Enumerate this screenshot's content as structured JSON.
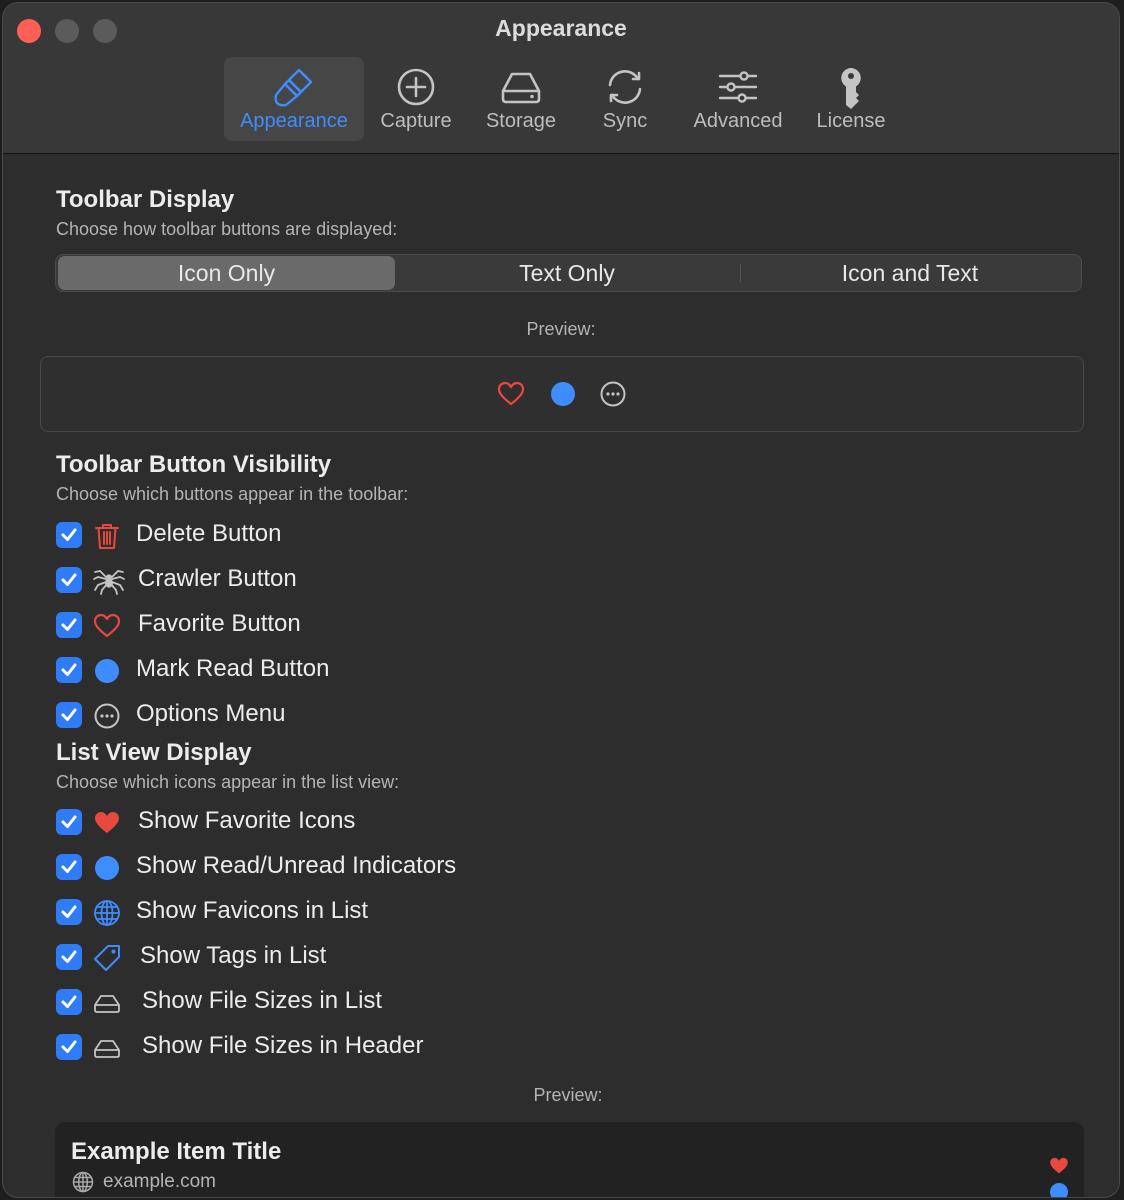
{
  "window": {
    "title": "Appearance"
  },
  "tabs": [
    {
      "label": "Appearance",
      "icon": "paintbrush-icon",
      "selected": true
    },
    {
      "label": "Capture",
      "icon": "plus-circle-icon",
      "selected": false
    },
    {
      "label": "Storage",
      "icon": "drive-icon",
      "selected": false
    },
    {
      "label": "Sync",
      "icon": "sync-arrows-icon",
      "selected": false
    },
    {
      "label": "Advanced",
      "icon": "sliders-icon",
      "selected": false
    },
    {
      "label": "License",
      "icon": "key-icon",
      "selected": false
    }
  ],
  "toolbar_display": {
    "title": "Toolbar Display",
    "subtitle": "Choose how toolbar buttons are displayed:",
    "options": [
      "Icon Only",
      "Text Only",
      "Icon and Text"
    ],
    "selected": "Icon Only",
    "preview_label": "Preview:"
  },
  "button_visibility": {
    "title": "Toolbar Button Visibility",
    "subtitle": "Choose which buttons appear in the toolbar:",
    "items": [
      {
        "label": "Delete Button",
        "icon": "trash-icon",
        "checked": true
      },
      {
        "label": "Crawler Button",
        "icon": "spider-icon",
        "checked": true
      },
      {
        "label": "Favorite Button",
        "icon": "heart-outline-icon",
        "checked": true
      },
      {
        "label": "Mark Read Button",
        "icon": "blue-dot-icon",
        "checked": true
      },
      {
        "label": "Options Menu",
        "icon": "ellipsis-circle-icon",
        "checked": true
      }
    ]
  },
  "list_view": {
    "title": "List View Display",
    "subtitle": "Choose which icons appear in the list view:",
    "items": [
      {
        "label": "Show Favorite Icons",
        "icon": "heart-filled-icon",
        "checked": true
      },
      {
        "label": "Show Read/Unread Indicators",
        "icon": "blue-dot-icon",
        "checked": true
      },
      {
        "label": "Show Favicons in List",
        "icon": "globe-icon",
        "checked": true
      },
      {
        "label": "Show Tags in List",
        "icon": "tag-icon",
        "checked": true
      },
      {
        "label": "Show File Sizes in List",
        "icon": "drive-icon",
        "checked": true
      },
      {
        "label": "Show File Sizes in Header",
        "icon": "drive-icon",
        "checked": true
      }
    ],
    "preview_label": "Preview:",
    "example": {
      "title": "Example Item Title",
      "domain": "example.com"
    }
  },
  "colors": {
    "accent": "#3f8cff",
    "checkbox": "#2f7cf6",
    "favorite_red": "#e8493f",
    "close_button": "#ff5f57"
  }
}
